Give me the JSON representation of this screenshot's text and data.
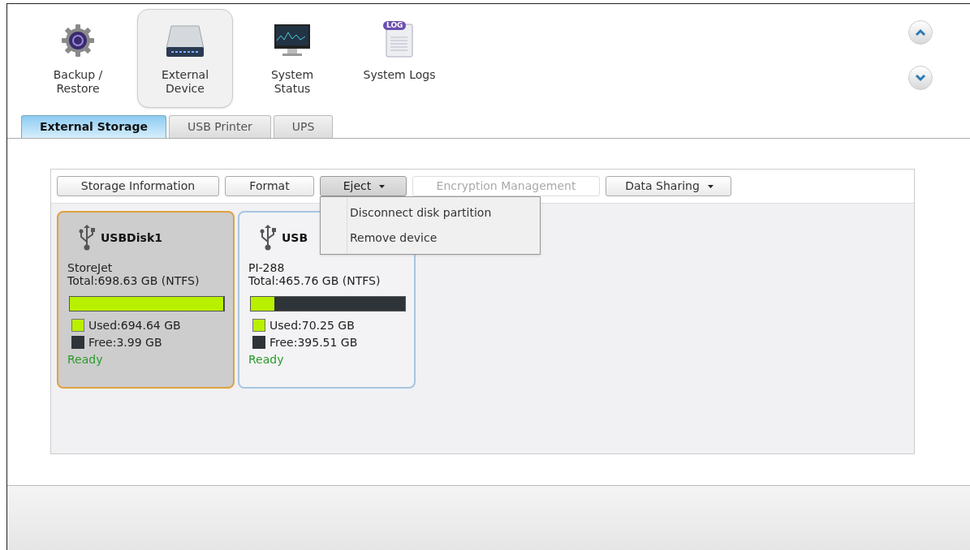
{
  "nav": [
    {
      "label": "Backup /\nRestore",
      "kind": "gear",
      "selected": false
    },
    {
      "label": "External\nDevice",
      "kind": "drive",
      "selected": true
    },
    {
      "label": "System\nStatus",
      "kind": "monitor",
      "selected": false
    },
    {
      "label": "System Logs",
      "kind": "log",
      "selected": false
    }
  ],
  "log_badge": "LOG",
  "tabs": [
    {
      "label": "External Storage",
      "selected": true
    },
    {
      "label": "USB Printer",
      "selected": false
    },
    {
      "label": "UPS",
      "selected": false
    }
  ],
  "toolbar": [
    {
      "label": "Storage Information",
      "kind": "button",
      "disabled": false,
      "open": false
    },
    {
      "label": "Format",
      "kind": "button",
      "disabled": false,
      "open": false
    },
    {
      "label": "Eject",
      "kind": "dropdown",
      "disabled": false,
      "open": true
    },
    {
      "label": "Encryption Management",
      "kind": "button",
      "disabled": true,
      "open": false
    },
    {
      "label": "Data Sharing",
      "kind": "dropdown",
      "disabled": false,
      "open": false
    }
  ],
  "eject_menu": [
    "Disconnect disk partition",
    "Remove device"
  ],
  "disks": [
    {
      "name": "USBDisk1",
      "model": "StoreJet",
      "total": "Total:698.63 GB (NTFS)",
      "level": 0.994,
      "used": "Used:694.64 GB",
      "free": "Free:3.99 GB",
      "status": "Ready",
      "selected": true
    },
    {
      "name": "USB",
      "model": "PI-288",
      "total": "Total:465.76 GB (NTFS)",
      "level": 0.15,
      "used": "Used:70.25 GB",
      "free": "Free:395.51 GB",
      "status": "Ready",
      "selected": false
    }
  ]
}
